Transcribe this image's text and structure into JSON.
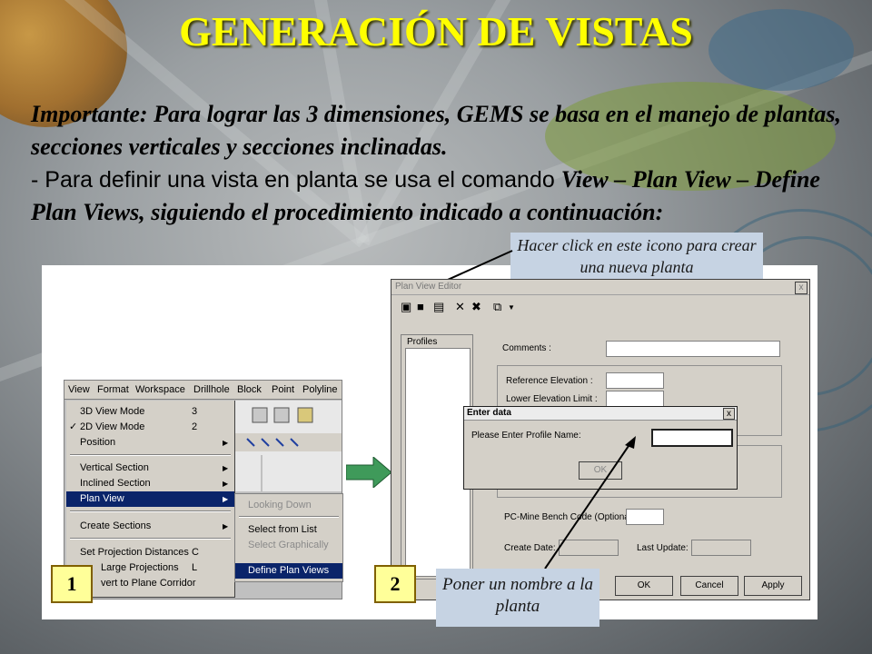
{
  "slide": {
    "title": "GENERACIÓN DE VISTAS",
    "line1_bold": "Importante: Para lograr las 3 dimensiones, GEMS se basa en el manejo de plantas, secciones verticales y secciones inclinadas.",
    "line2_plain": "- Para definir una vista en planta se usa el comando ",
    "line2_cmd": "View – Plan View – Define Plan Views, siguiendo el procedimiento indicado a continuación:",
    "tip_top": "Hacer click en este icono para crear una nueva planta",
    "tip_bottom": "Poner un nombre a la planta",
    "step1": "1",
    "step2": "2"
  },
  "menubar": {
    "items": [
      "View",
      "Format",
      "Workspace",
      "Drillhole",
      "Block",
      "Point",
      "Polyline"
    ]
  },
  "view_menu": {
    "items": [
      {
        "label": "3D View Mode",
        "shortcut": "3"
      },
      {
        "label": "2D View Mode",
        "shortcut": "2",
        "check": "✓"
      },
      {
        "label": "Position"
      },
      {
        "label": "Vertical Section"
      },
      {
        "label": "Inclined Section"
      },
      {
        "label": "Plan View"
      },
      {
        "label": "Create Sections"
      },
      {
        "label": "Set Projection Distances",
        "shortcut": "C"
      },
      {
        "label": "Large Projections",
        "shortcut": "L"
      },
      {
        "label": "vert to Plane Corridor"
      }
    ]
  },
  "plan_submenu": {
    "items": [
      "Looking Down",
      "Select from List",
      "Select Graphically",
      "Define Plan Views"
    ]
  },
  "plan_editor": {
    "title": "Plan View Editor",
    "close": "x",
    "profiles_label": "Profiles",
    "comments_label": "Comments :",
    "ref_elev_label": "Reference Elevation :",
    "lower_elev_label": "Lower Elevation Limit :",
    "bench_code_label": "PC-Mine Bench Code (Optional):",
    "create_date_label": "Create Date:",
    "last_update_label": "Last Update:",
    "ok": "OK",
    "cancel": "Cancel",
    "apply": "Apply"
  },
  "enter_dialog": {
    "title": "Enter data",
    "close": "x",
    "prompt": "Please Enter Profile Name:",
    "ok": "OK"
  }
}
